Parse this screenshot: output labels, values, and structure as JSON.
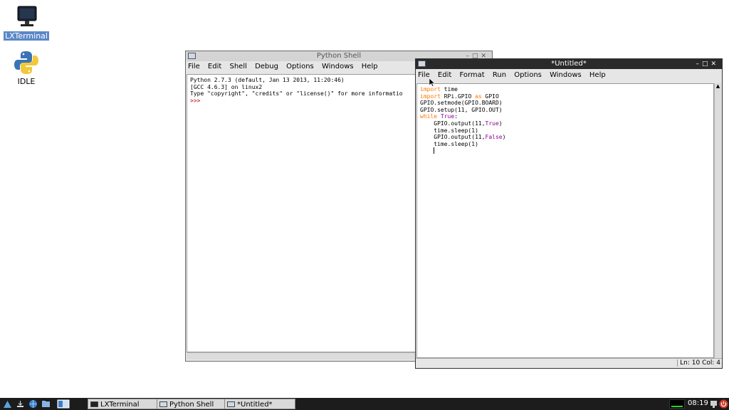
{
  "desktop": {
    "icons": [
      {
        "label": "LXTerminal"
      },
      {
        "label": "IDLE"
      }
    ]
  },
  "shell_window": {
    "title": "Python Shell",
    "menu": [
      "File",
      "Edit",
      "Shell",
      "Debug",
      "Options",
      "Windows",
      "Help"
    ],
    "lines": [
      "Python 2.7.3 (default, Jan 13 2013, 11:20:46)",
      "[GCC 4.6.3] on linux2",
      "Type \"copyright\", \"credits\" or \"license()\" for more informatio"
    ],
    "prompt": ">>>"
  },
  "editor_window": {
    "title": "*Untitled*",
    "menu": [
      "File",
      "Edit",
      "Format",
      "Run",
      "Options",
      "Windows",
      "Help"
    ],
    "status": "Ln: 10 Col: 4",
    "code": {
      "l1_kw": "import",
      "l1_rest": " time",
      "l2_kw": "import",
      "l2_mid": " RPi.GPIO ",
      "l2_kw2": "as",
      "l2_rest": " GPIO",
      "l3": "GPIO.setmode(GPIO.BOARD)",
      "l4": "GPIO.setup(11, GPIO.OUT)",
      "l5_kw": "while",
      "l5_sp": " ",
      "l5_bi": "True",
      "l5_rest": ":",
      "l6_a": "    GPIO.output(11,",
      "l6_bi": "True",
      "l6_b": ")",
      "l7": "    time.sleep(1)",
      "l8_a": "    GPIO.output(11,",
      "l8_bi": "False",
      "l8_b": ")",
      "l9": "    time.sleep(1)",
      "l10": "    "
    }
  },
  "taskbar": {
    "tasks": [
      "LXTerminal",
      "Python Shell",
      "*Untitled*"
    ],
    "clock": "08:19"
  },
  "colors": {
    "keyword": "#ff7700",
    "builtin": "#900090",
    "prompt": "#c00000",
    "active_title": "#2a2a2a",
    "taskbar": "#1c1c1c"
  }
}
